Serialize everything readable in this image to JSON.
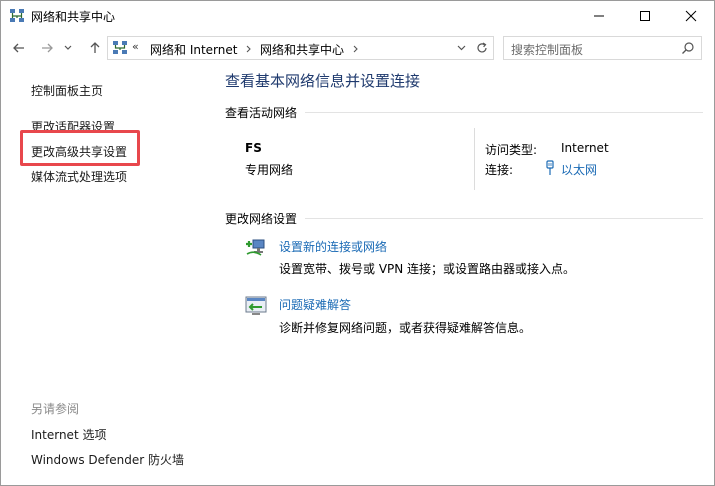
{
  "window": {
    "title": "网络和共享中心",
    "controls": {
      "minimize_icon": "minimize-icon",
      "maximize_icon": "maximize-icon",
      "close_icon": "close-icon"
    }
  },
  "address_bar": {
    "overflow": "«",
    "crumbs": [
      "网络和 Internet",
      "网络和共享中心"
    ],
    "search_placeholder": "搜索控制面板"
  },
  "sidebar": {
    "home": "控制面板主页",
    "links": [
      "更改适配器设置",
      "更改高级共享设置",
      "媒体流式处理选项"
    ],
    "see_also_heading": "另请参阅",
    "see_also": [
      "Internet 选项",
      "Windows Defender 防火墙"
    ],
    "highlight_color": "#e8474c"
  },
  "main": {
    "title": "查看基本网络信息并设置连接",
    "active_section": "查看活动网络",
    "network": {
      "name": "FS",
      "type": "专用网络",
      "access_label": "访问类型:",
      "access_value": "Internet",
      "conn_label": "连接:",
      "conn_value": "以太网"
    },
    "change_section": "更改网络设置",
    "tasks": [
      {
        "link": "设置新的连接或网络",
        "desc": "设置宽带、拨号或 VPN 连接；或设置路由器或接入点。",
        "icon": "new-connection-icon"
      },
      {
        "link": "问题疑难解答",
        "desc": "诊断并修复网络问题，或者获得疑难解答信息。",
        "icon": "troubleshoot-icon"
      }
    ],
    "link_color": "#1a6ab5",
    "title_color": "#1f3a6e"
  }
}
